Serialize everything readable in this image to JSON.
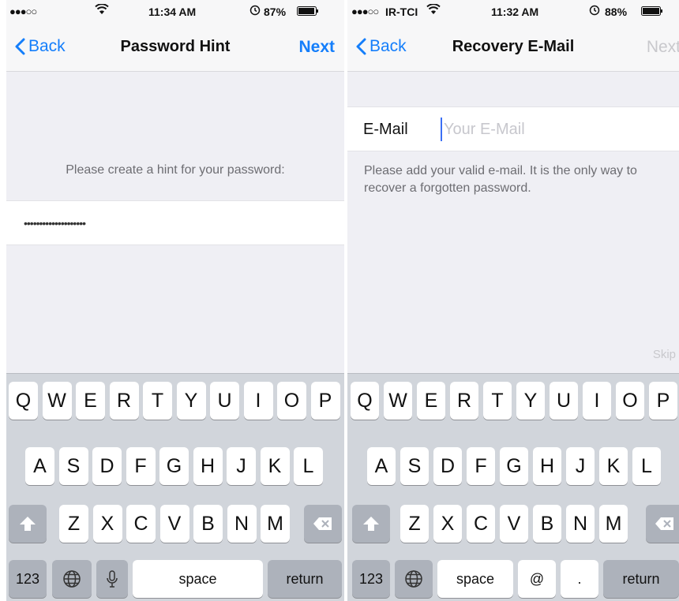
{
  "left": {
    "statusbar": {
      "signal": "●●●○○",
      "time": "11:34 AM",
      "battery": "87%"
    },
    "navbar": {
      "back": "Back",
      "title": "Password Hint",
      "next": "Next"
    },
    "hint_prompt": "Please create a hint for your password:",
    "hint_value": "••••••••••••••••••••",
    "keyboard": {
      "row1": [
        "Q",
        "W",
        "E",
        "R",
        "T",
        "Y",
        "U",
        "I",
        "O",
        "P"
      ],
      "row2": [
        "A",
        "S",
        "D",
        "F",
        "G",
        "H",
        "J",
        "K",
        "L"
      ],
      "row3": [
        "Z",
        "X",
        "C",
        "V",
        "B",
        "N",
        "M"
      ],
      "numbers": "123",
      "space": "space",
      "return": "return"
    }
  },
  "right": {
    "statusbar": {
      "signal": "●●●○○",
      "carrier": "IR-TCI",
      "time": "11:32 AM",
      "battery": "88%"
    },
    "navbar": {
      "back": "Back",
      "title": "Recovery E-Mail",
      "next": "Next"
    },
    "email_label": "E-Mail",
    "email_placeholder": "Your E-Mail",
    "email_help": "Please add your valid e-mail. It is the only way to recover a forgotten password.",
    "skip": "Skip",
    "keyboard": {
      "row1": [
        "Q",
        "W",
        "E",
        "R",
        "T",
        "Y",
        "U",
        "I",
        "O",
        "P"
      ],
      "row2": [
        "A",
        "S",
        "D",
        "F",
        "G",
        "H",
        "J",
        "K",
        "L"
      ],
      "row3": [
        "Z",
        "X",
        "C",
        "V",
        "B",
        "N",
        "M"
      ],
      "numbers": "123",
      "space": "space",
      "at": "@",
      "dot": ".",
      "return": "return"
    }
  },
  "colors": {
    "accent": "#147efb",
    "disabled": "#c8c8cc",
    "keyboard_bg": "#d1d5db"
  },
  "icons": [
    "chevron-left-icon",
    "wifi-icon",
    "alarm-icon",
    "battery-icon",
    "shift-icon",
    "delete-icon",
    "globe-icon",
    "microphone-icon"
  ]
}
